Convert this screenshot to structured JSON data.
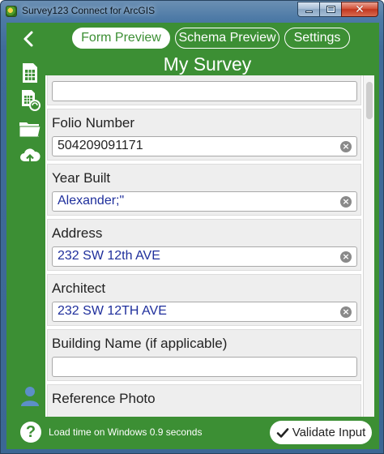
{
  "window": {
    "title": "Survey123 Connect for ArcGIS",
    "close_glyph": "✕"
  },
  "nav": {
    "back_icon": "chevron-left-icon",
    "tabs": [
      {
        "label": "Form Preview",
        "active": true
      },
      {
        "label": "Schema Preview",
        "active": false
      },
      {
        "label": "Settings",
        "active": false
      }
    ]
  },
  "sidebar": {
    "icons": [
      "spreadsheet-icon",
      "spreadsheet-refresh-icon",
      "folder-icon",
      "cloud-upload-icon",
      "user-icon"
    ]
  },
  "survey": {
    "title": "My Survey",
    "questions": [
      {
        "label": "Folio Number",
        "value": "504209091171",
        "value_color": "dark"
      },
      {
        "label": "Year Built",
        "value": "Alexander;\"",
        "value_color": "blue"
      },
      {
        "label": "Address",
        "value": "232 SW 12th AVE",
        "value_color": "blue"
      },
      {
        "label": "Architect",
        "value": "232 SW 12TH AVE",
        "value_color": "blue"
      },
      {
        "label": "Building Name (if applicable)",
        "value": ""
      },
      {
        "label": "Reference Photo"
      }
    ],
    "clear_glyph": "×"
  },
  "footer": {
    "help_glyph": "?",
    "load_time": "Load time on Windows 0.9 seconds",
    "validate_label": "Validate Input"
  },
  "colors": {
    "primary_green": "#3c8f34",
    "input_value_blue": "#1f2f9c",
    "question_bg": "#eeeeee"
  }
}
